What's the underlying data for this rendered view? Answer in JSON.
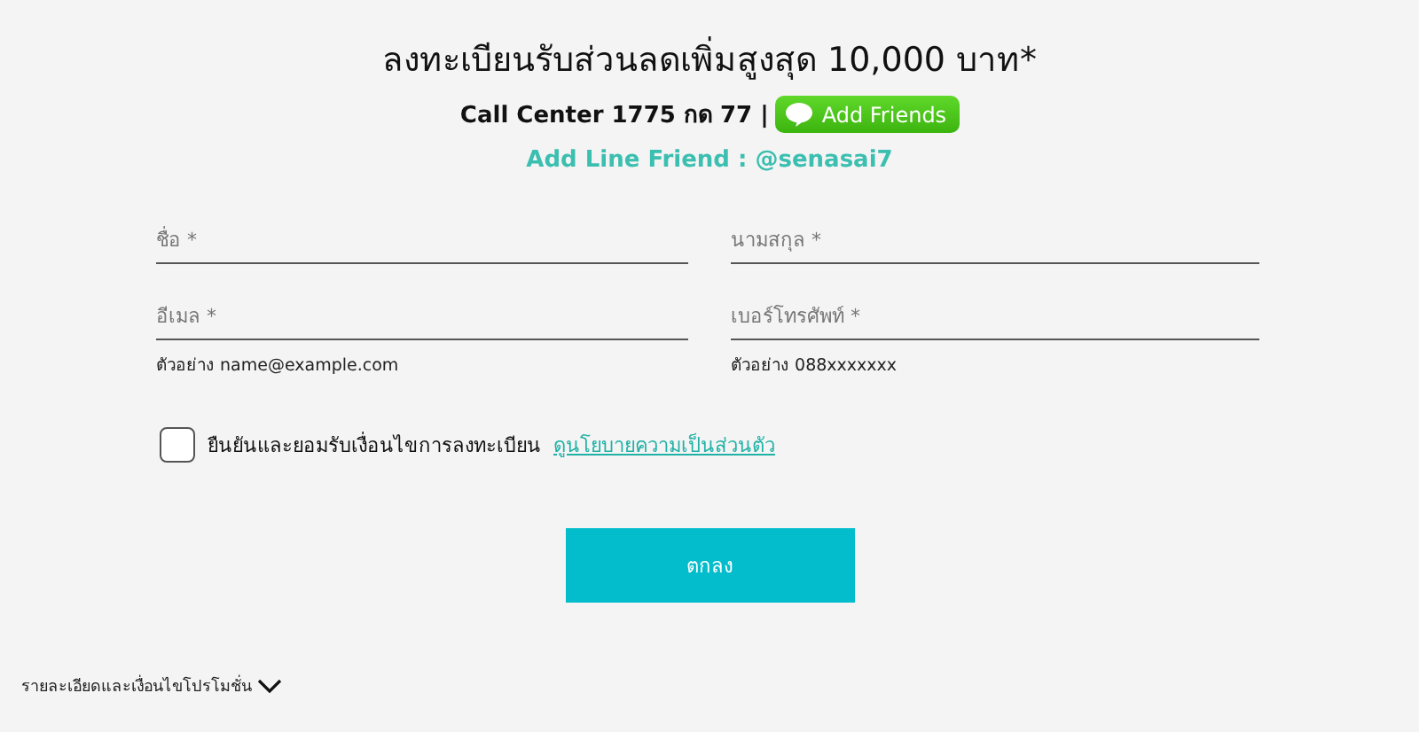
{
  "header": {
    "title": "ลงทะเบียนรับส่วนลดเพิ่มสูงสุด 10,000 บาท*",
    "call_center": "Call Center 1775 กด 77 |",
    "line_button": "Add Friends",
    "line_friend": "Add Line Friend : @senasai7"
  },
  "fields": [
    {
      "label": "ชื่อ *"
    },
    {
      "label": "นามสกุล *"
    },
    {
      "label": "อีเมล *",
      "hint": "ตัวอย่าง name@example.com"
    },
    {
      "label": "เบอร์โทรศัพท์ *",
      "hint": "ตัวอย่าง 088xxxxxxx"
    }
  ],
  "consent": {
    "checked": false,
    "text": "ยืนยันและยอมรับเงื่อนไขการลงทะเบียน",
    "link": "ดูนโยบายความเป็นส่วนตัว"
  },
  "submit": "ตกลง",
  "terms": {
    "label": "รายละเอียดและเงื่อนไขโปรโมชั่น",
    "expanded": false
  }
}
